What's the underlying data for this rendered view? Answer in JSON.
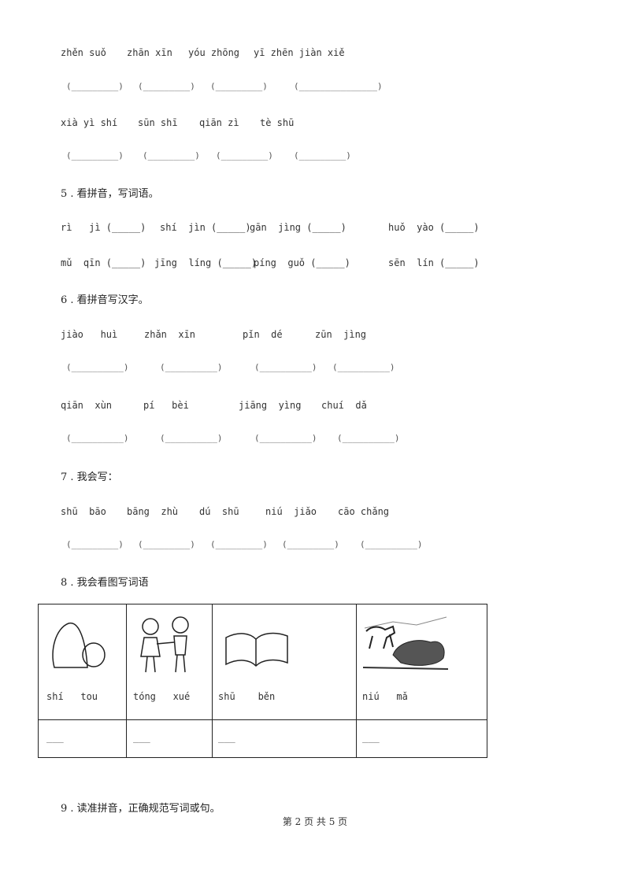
{
  "q4": {
    "row1": {
      "pinyin": [
        "zhěn suǒ",
        "zhān xīn",
        "yóu zhōng",
        "yī zhēn jiàn xiě"
      ],
      "blanks": [
        "(_________)",
        "(_________)",
        "(_________)",
        "(_______________)"
      ]
    },
    "row2": {
      "pinyin": [
        "xià yì shí",
        "sūn shī",
        "qiān zì",
        "tè shū"
      ],
      "blanks": [
        "(_________)",
        "(_________)",
        "(_________)",
        "(_________)"
      ]
    }
  },
  "q5": {
    "title": "5 . 看拼音，写词语。",
    "row1": [
      "rì   jì (_____)",
      "shí  jìn (_____)",
      "gān  jìng (_____)",
      "huǒ  yào (_____)"
    ],
    "row2": [
      "mǔ  qīn (_____)",
      "jīng  líng (_____)",
      "píng  guǒ (_____)",
      "sēn  lín (_____)"
    ]
  },
  "q6": {
    "title": "6 . 看拼音写汉字。",
    "row1": {
      "pinyin": [
        "jiào   huì",
        "zhǎn  xīn",
        "pǐn  dé",
        "zūn  jìng"
      ],
      "blanks": [
        "(__________)",
        "(__________)",
        "(__________)",
        "(__________)"
      ]
    },
    "row2": {
      "pinyin": [
        "qiān  xùn",
        "pí   bèi",
        "jiāng  yìng",
        "chuí  dǎ"
      ],
      "blanks": [
        "(__________)",
        "(__________)",
        "(__________)",
        "(__________)"
      ]
    }
  },
  "q7": {
    "title": "7 . 我会写：",
    "pinyin": [
      "shū  bāo",
      "bāng  zhù",
      "dú  shū",
      "niú  jiǎo",
      "cāo chǎng"
    ],
    "blanks": [
      "(_________)",
      "(_________)",
      "(_________)",
      "(_________)",
      "(__________)"
    ]
  },
  "q8": {
    "title": "8 . 我会看图写词语",
    "cells": [
      {
        "pinyin": "shí   tou",
        "answer": "___",
        "picture": "stone"
      },
      {
        "pinyin": "tóng   xué",
        "answer": "___",
        "picture": "classmates"
      },
      {
        "pinyin": "shū    běn",
        "answer": "___",
        "picture": "book"
      },
      {
        "pinyin": "niú   mǎ",
        "answer": "___",
        "picture": "cow-and-horse"
      }
    ]
  },
  "q9": {
    "title": "9 . 读准拼音，正确规范写词或句。"
  },
  "footer": "第 2 页 共 5 页"
}
